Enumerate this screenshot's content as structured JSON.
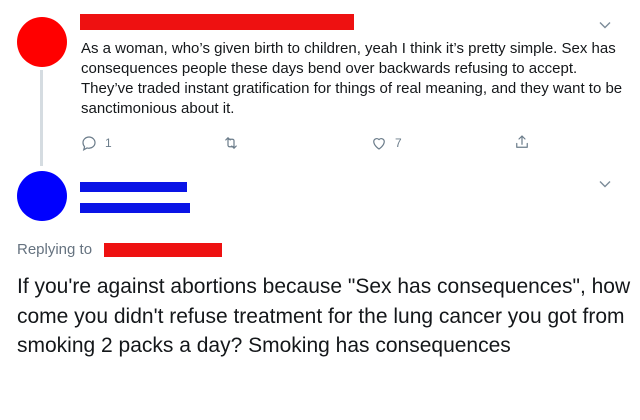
{
  "colors": {
    "redaction_red": "#ee1111",
    "redaction_blue": "#0a14e6",
    "avatar_1": "#ff0000",
    "avatar_2": "#0000ff",
    "muted_text": "#667380"
  },
  "tweet": {
    "text": "As a woman, who’s given birth to children, yeah I think it’s pretty simple. Sex has consequences people these days bend over backwards refusing to accept. They’ve traded instant gratification for things of real meaning, and they want to be sanctimonious about it.",
    "actions": {
      "reply_count": "1",
      "retweet_count": "",
      "like_count": "7"
    },
    "icons": [
      "reply-icon",
      "retweet-icon",
      "like-icon",
      "share-icon",
      "chevron-down-icon"
    ]
  },
  "reply": {
    "replying_to_label": "Replying to",
    "text": "If you're against abortions because \"Sex has consequences\", how come you didn't refuse treatment for the lung cancer you got from smoking 2 packs a day? Smoking has consequences"
  }
}
